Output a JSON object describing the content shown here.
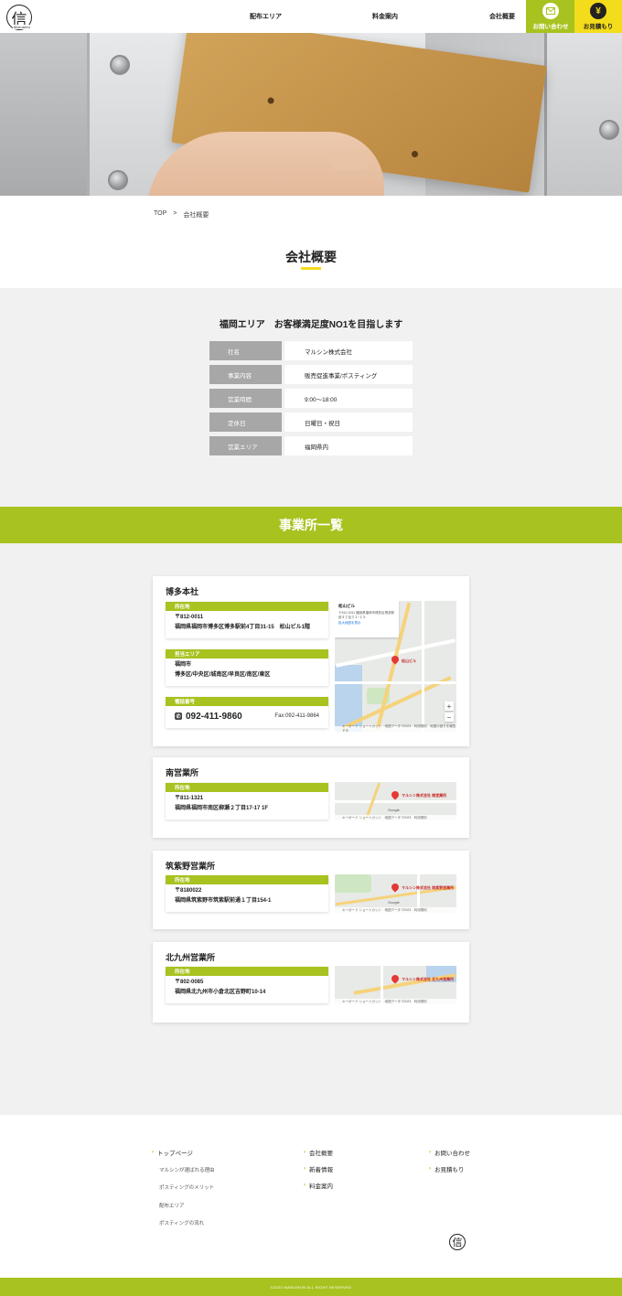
{
  "header": {
    "logo_char": "信",
    "logo_sub": "Marushin",
    "nav": [
      "配布エリア",
      "料金案内",
      "会社概要"
    ],
    "contact_label": "お問い合わせ",
    "quote_label": "お見積もり",
    "quote_glyph": "¥",
    "contact_icon": "mail-icon"
  },
  "breadcrumb": {
    "home": "TOP",
    "sep": ">",
    "current": "会社概要"
  },
  "page_title": "会社概要",
  "company": {
    "heading": "福岡エリア　お客様満足度NO1を目指します",
    "rows": [
      {
        "label": "社名",
        "value": "マルシン株式会社"
      },
      {
        "label": "事業内容",
        "value": "販売促進事業/ポスティング"
      },
      {
        "label": "営業時間",
        "value": "9:00〜18:00"
      },
      {
        "label": "定休日",
        "value": "日曜日・祝日"
      },
      {
        "label": "営業エリア",
        "value": "福岡県内"
      }
    ]
  },
  "offices_title": "事業所一覧",
  "offices": [
    {
      "name": "博多本社",
      "address_label": "所在地",
      "postal": "〒812-0011",
      "address": "福岡県福岡市博多区博多駅前4丁目31-15　松山ビル1階",
      "area_label": "担当エリア",
      "area_line1": "福岡市",
      "area_line2": "博多区/中央区/城南区/早良区/南区/東区",
      "phone_label": "電話番号",
      "phone": "092-411-9860",
      "fax": "Fax:092-411-9864",
      "map": {
        "place": "松山ビル",
        "place_addr": "〒812-0011 福岡県福岡市博多区博多駅前４丁目３１−１５",
        "link": "拡大地図を表示",
        "pin_label": "松山ビル",
        "footer": "キーボード ショートカット　地図データ ©2023　利用規約　地図の誤りを報告する"
      }
    },
    {
      "name": "南営業所",
      "address_label": "所在地",
      "postal": "〒811-1321",
      "address": "福岡県福岡市南区柳瀬２丁目17-17 1F",
      "map": {
        "pin_label": "マルシン株式会社 南営業所",
        "footer": "キーボード ショートカット　地図データ ©2023　利用規約",
        "brand": "Google"
      }
    },
    {
      "name": "筑紫野営業所",
      "address_label": "所在地",
      "postal": "〒8180022",
      "address": "福岡県筑紫野市筑紫駅前通１丁目154-1",
      "map": {
        "pin_label": "マルシン株式会社 筑紫野営業所",
        "footer": "キーボード ショートカット　地図データ ©2023　利用規約",
        "brand": "Google"
      }
    },
    {
      "name": "北九州営業所",
      "address_label": "所在地",
      "postal": "〒802-0085",
      "address": "福岡県北九州市小倉北区吉野町10-14",
      "map": {
        "pin_label": "マルシン株式会社 北九州営業所",
        "footer": "キーボード ショートカット　地図データ ©2023　利用規約",
        "brand": "Google"
      }
    }
  ],
  "footer": {
    "col1": {
      "main": "トップページ",
      "subs": [
        "マルシンが選ばれる理由",
        "ポスティングのメリット",
        "配布エリア",
        "ポスティングの流れ"
      ]
    },
    "col2": [
      "会社概要",
      "新着情報",
      "料金案内"
    ],
    "col3": [
      "お問い合わせ",
      "お見積もり"
    ],
    "logo_char": "信",
    "copyright": "©2023 MARUSHIN ALL RIGHT RESERVED"
  },
  "colors": {
    "accent": "#a8c21f",
    "yellow": "#f3dc1b",
    "label_gray": "#a7a7a7"
  }
}
